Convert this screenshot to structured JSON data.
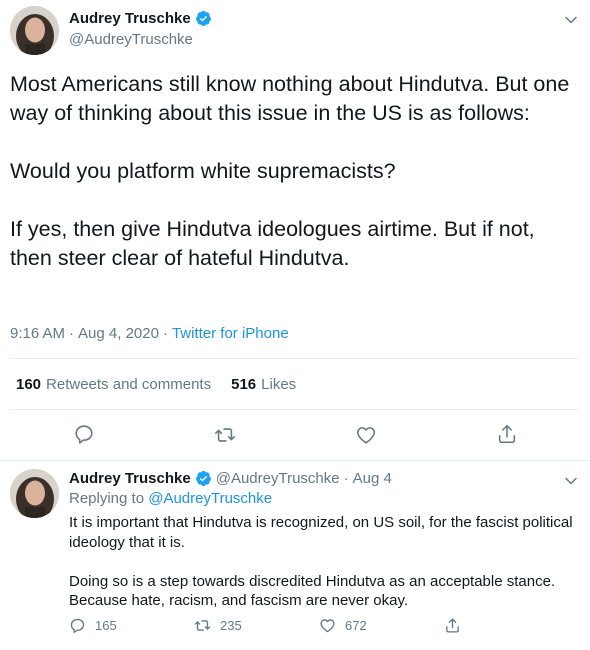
{
  "main_tweet": {
    "display_name": "Audrey Truschke",
    "handle": "@AudreyTruschke",
    "text": "Most Americans still know nothing about Hindutva. But one way of thinking about this issue in the US is as follows:\n\nWould you platform white supremacists?\n\nIf yes, then give Hindutva ideologues airtime. But if not, then steer clear of hateful Hindutva.",
    "time": "9:16 AM",
    "date": "Aug 4, 2020",
    "separator": "·",
    "source": "Twitter for iPhone",
    "retweets_count": "160",
    "retweets_label": "Retweets and comments",
    "likes_count": "516",
    "likes_label": "Likes",
    "icons": [
      "avatar",
      "verified-badge-icon",
      "chevron-down-icon",
      "reply-icon",
      "retweet-icon",
      "like-icon",
      "share-icon"
    ]
  },
  "reply_tweet": {
    "display_name": "Audrey Truschke",
    "handle": "@AudreyTruschke",
    "separator": "·",
    "date": "Aug 4",
    "replying_prefix": "Replying to",
    "replying_to": "@AudreyTruschke",
    "text": "It is important that Hindutva is recognized, on US soil, for the fascist political ideology that it is.\n\nDoing so is a step towards discredited Hindutva as an acceptable stance. Because hate, racism, and fascism are never okay.",
    "reply_count": "165",
    "retweet_count": "235",
    "like_count": "672"
  },
  "colors": {
    "text": "#14171a",
    "secondary": "#657786",
    "link": "#1b95e0",
    "divider": "#e6ecf0",
    "verified": "#1da1f2"
  }
}
